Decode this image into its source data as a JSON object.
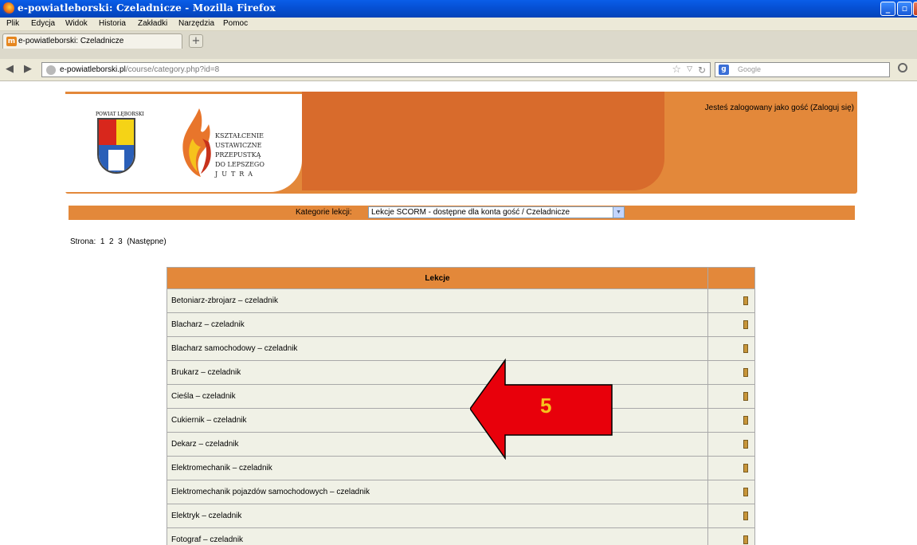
{
  "window": {
    "title": "e-powiatleborski: Czeladnicze - Mozilla Firefox"
  },
  "menu": [
    "Plik",
    "Edycja",
    "Widok",
    "Historia",
    "Zakładki",
    "Narzędzia",
    "Pomoc"
  ],
  "tab": {
    "label": "e-powiatleborski: Czeladnicze"
  },
  "address": {
    "host": "e-powiatleborski.pl",
    "path": "/course/category.php?id=8"
  },
  "search": {
    "placeholder": "Google"
  },
  "header": {
    "login_text": "Jesteś zalogowany jako gość (Zaloguj się)",
    "coat_caption": "POWIAT LĘBORSKI",
    "motto": [
      "KSZTAŁCENIE",
      "USTAWICZNE",
      "PRZEPUSTKĄ",
      "DO LEPSZEGO",
      "JUTRA"
    ]
  },
  "category": {
    "label": "Kategorie lekcji:",
    "selected": "Lekcje SCORM - dostępne dla konta gość / Czeladnicze"
  },
  "pager": {
    "label": "Strona:",
    "pages": [
      "1",
      "2",
      "3"
    ],
    "next": "(Następne)"
  },
  "table": {
    "header": "Lekcje",
    "rows": [
      "Betoniarz-zbrojarz – czeladnik",
      "Blacharz – czeladnik",
      "Blacharz samochodowy – czeladnik",
      "Brukarz – czeladnik",
      "Cieśla – czeladnik",
      "Cukiernik – czeladnik",
      "Dekarz – czeladnik",
      "Elektromechanik – czeladnik",
      "Elektromechanik pojazdów samochodowych – czeladnik",
      "Elektryk – czeladnik",
      "Fotograf – czeladnik"
    ]
  },
  "annotation": {
    "number": "5",
    "arrow_color": "#e8000b"
  }
}
